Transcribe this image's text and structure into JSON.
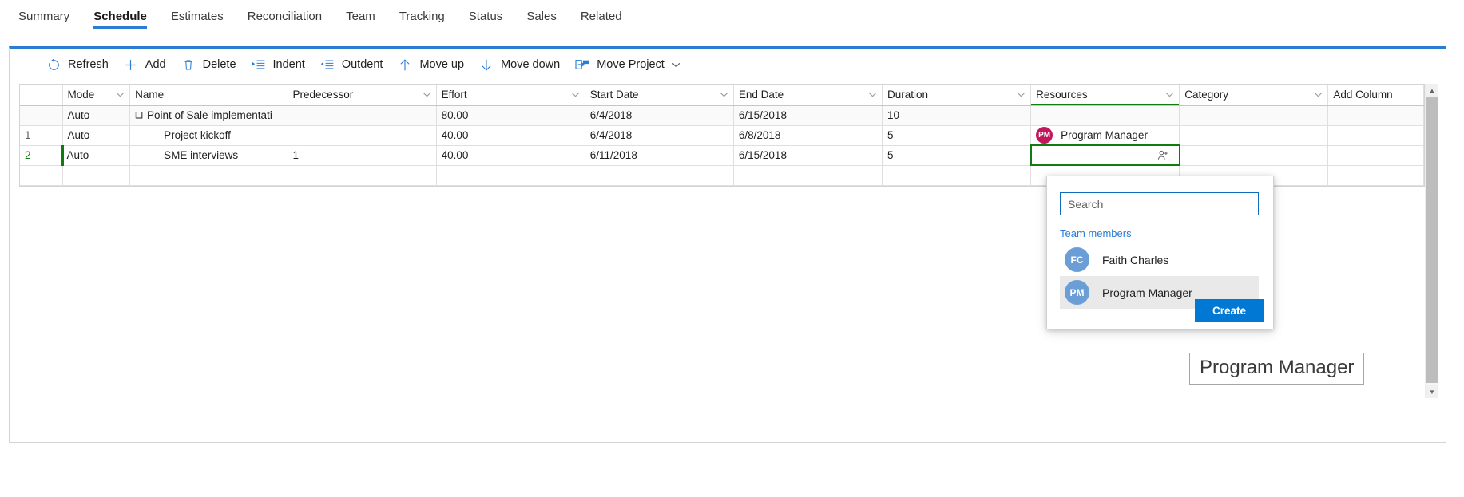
{
  "tabs": [
    {
      "label": "Summary",
      "active": false
    },
    {
      "label": "Schedule",
      "active": true
    },
    {
      "label": "Estimates",
      "active": false
    },
    {
      "label": "Reconciliation",
      "active": false
    },
    {
      "label": "Team",
      "active": false
    },
    {
      "label": "Tracking",
      "active": false
    },
    {
      "label": "Status",
      "active": false
    },
    {
      "label": "Sales",
      "active": false
    },
    {
      "label": "Related",
      "active": false
    }
  ],
  "toolbar": {
    "refresh": "Refresh",
    "add": "Add",
    "delete": "Delete",
    "indent": "Indent",
    "outdent": "Outdent",
    "move_up": "Move up",
    "move_down": "Move down",
    "move_project": "Move Project"
  },
  "grid": {
    "columns": [
      {
        "label": "",
        "chevron": false
      },
      {
        "label": "Mode",
        "chevron": true
      },
      {
        "label": "Name",
        "chevron": false
      },
      {
        "label": "Predecessor",
        "chevron": true
      },
      {
        "label": "Effort",
        "chevron": true
      },
      {
        "label": "Start Date",
        "chevron": true
      },
      {
        "label": "End Date",
        "chevron": true
      },
      {
        "label": "Duration",
        "chevron": true
      },
      {
        "label": "Resources",
        "chevron": true
      },
      {
        "label": "Category",
        "chevron": true
      },
      {
        "label": "Add Column",
        "chevron": false
      }
    ],
    "rows": [
      {
        "num": "",
        "mode": "Auto",
        "name": "Point of Sale implementati",
        "predecessor": "",
        "effort": "80.00",
        "start_date": "6/4/2018",
        "end_date": "6/15/2018",
        "duration": "10",
        "resource_name": "",
        "resource_initials": "",
        "category": ""
      },
      {
        "num": "1",
        "mode": "Auto",
        "name": "Project kickoff",
        "predecessor": "",
        "effort": "40.00",
        "start_date": "6/4/2018",
        "end_date": "6/8/2018",
        "duration": "5",
        "resource_name": "Program Manager",
        "resource_initials": "PM",
        "category": ""
      },
      {
        "num": "2",
        "mode": "Auto",
        "name": "SME interviews",
        "predecessor": "1",
        "effort": "40.00",
        "start_date": "6/11/2018",
        "end_date": "6/15/2018",
        "duration": "5",
        "resource_name": "",
        "resource_initials": "",
        "category": ""
      }
    ]
  },
  "flyout": {
    "search_placeholder": "Search",
    "search_value": "",
    "section_label": "Team members",
    "members": [
      {
        "initials": "FC",
        "name": "Faith Charles",
        "highlighted": false
      },
      {
        "initials": "PM",
        "name": "Program Manager",
        "highlighted": true
      }
    ],
    "create_label": "Create"
  },
  "tooltip": {
    "text": "Program Manager"
  },
  "colors": {
    "accent_blue": "#2b7cd3",
    "primary_button": "#0078d4",
    "resource_header_green": "#107c10",
    "avatar_red": "#c2185b",
    "avatar_blue": "#6b9ed6"
  }
}
